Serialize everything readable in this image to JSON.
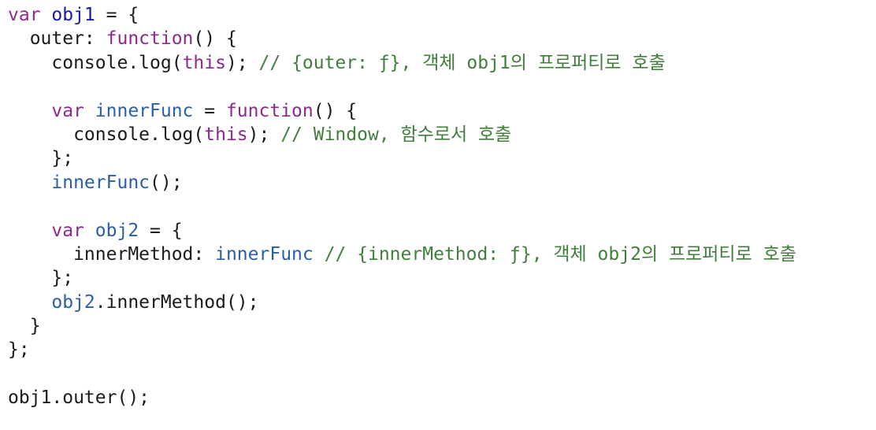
{
  "editor": {
    "lines": [
      [
        {
          "text": "var ",
          "type": "keyword"
        },
        {
          "text": "obj1",
          "type": "var"
        },
        {
          "text": " = {",
          "type": "plain"
        }
      ],
      [
        {
          "text": "  outer: ",
          "type": "plain"
        },
        {
          "text": "function",
          "type": "keyword"
        },
        {
          "text": "() {",
          "type": "plain"
        }
      ],
      [
        {
          "text": "    console.log(",
          "type": "plain"
        },
        {
          "text": "this",
          "type": "keyword"
        },
        {
          "text": "); ",
          "type": "plain"
        },
        {
          "text": "// {outer: ƒ}, 객체 obj1의 프로퍼티로 호출",
          "type": "comment"
        }
      ],
      [],
      [
        {
          "text": "    ",
          "type": "plain"
        },
        {
          "text": "var ",
          "type": "keyword"
        },
        {
          "text": "innerFunc",
          "type": "fn"
        },
        {
          "text": " = ",
          "type": "plain"
        },
        {
          "text": "function",
          "type": "keyword"
        },
        {
          "text": "() {",
          "type": "plain"
        }
      ],
      [
        {
          "text": "      console.log(",
          "type": "plain"
        },
        {
          "text": "this",
          "type": "keyword"
        },
        {
          "text": "); ",
          "type": "plain"
        },
        {
          "text": "// Window, 함수로서 호출",
          "type": "comment"
        }
      ],
      [
        {
          "text": "    };",
          "type": "plain"
        }
      ],
      [
        {
          "text": "    ",
          "type": "plain"
        },
        {
          "text": "innerFunc",
          "type": "fn"
        },
        {
          "text": "();",
          "type": "plain"
        }
      ],
      [],
      [
        {
          "text": "    ",
          "type": "plain"
        },
        {
          "text": "var ",
          "type": "keyword"
        },
        {
          "text": "obj2",
          "type": "fn"
        },
        {
          "text": " = {",
          "type": "plain"
        }
      ],
      [
        {
          "text": "      innerMethod: ",
          "type": "plain"
        },
        {
          "text": "innerFunc",
          "type": "fn"
        },
        {
          "text": " ",
          "type": "plain"
        },
        {
          "text": "// {innerMethod: ƒ}, 객체 obj2의 프로퍼티로 호출",
          "type": "comment"
        }
      ],
      [
        {
          "text": "    };",
          "type": "plain"
        }
      ],
      [
        {
          "text": "    ",
          "type": "plain"
        },
        {
          "text": "obj2",
          "type": "fn"
        },
        {
          "text": ".innerMethod();",
          "type": "plain"
        }
      ],
      [
        {
          "text": "  }",
          "type": "plain"
        }
      ],
      [
        {
          "text": "};",
          "type": "plain"
        }
      ],
      [],
      [
        {
          "text": "obj1.outer();",
          "type": "plain"
        }
      ]
    ]
  },
  "colors": {
    "keyword": "#8b2990",
    "var": "#1a1aa8",
    "fn": "#2b5ea7",
    "comment": "#3f7f3b",
    "plain": "#1a1a1a"
  }
}
